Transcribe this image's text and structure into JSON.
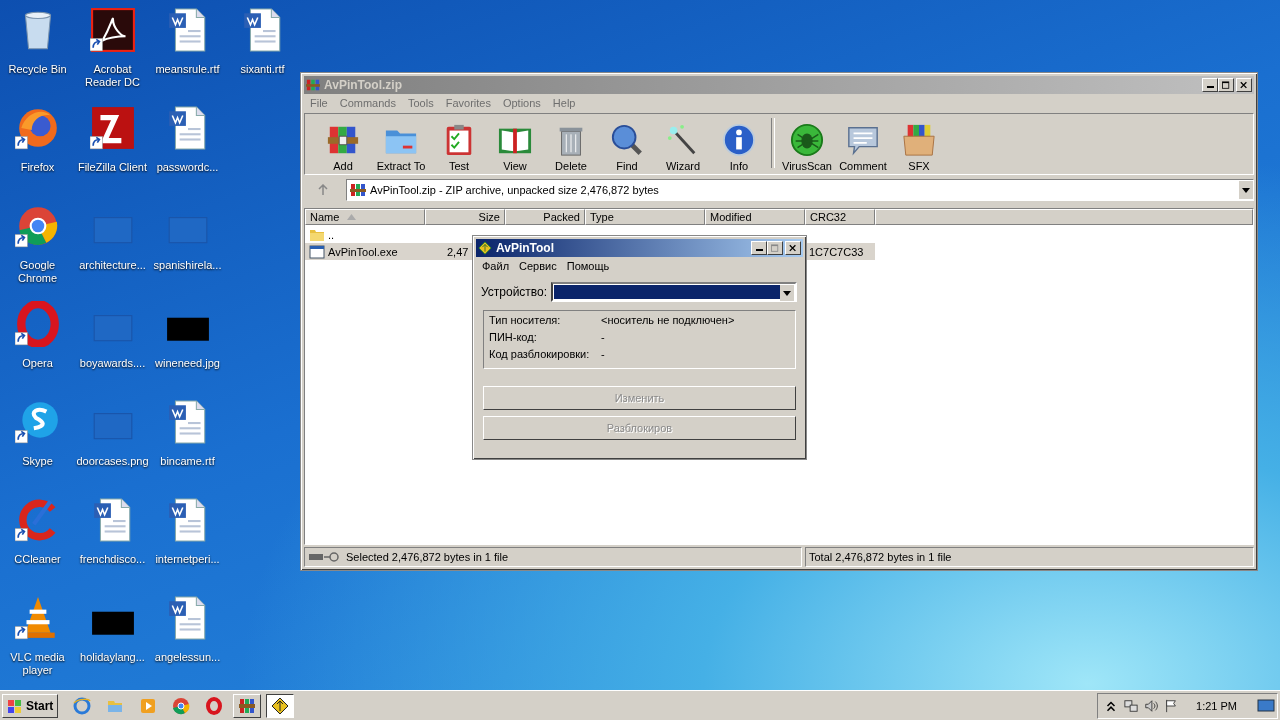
{
  "desktop": {
    "icons": [
      {
        "label": "Recycle Bin",
        "kind": "recycle",
        "shortcut": false
      },
      {
        "label": "Firefox",
        "kind": "firefox",
        "shortcut": true
      },
      {
        "label": "Google Chrome",
        "kind": "chrome",
        "shortcut": true
      },
      {
        "label": "Opera",
        "kind": "opera",
        "shortcut": true
      },
      {
        "label": "Skype",
        "kind": "skype",
        "shortcut": true
      },
      {
        "label": "CCleaner",
        "kind": "ccleaner",
        "shortcut": true
      },
      {
        "label": "VLC media player",
        "kind": "vlc",
        "shortcut": true
      },
      {
        "label": "Acrobat Reader DC",
        "kind": "acrobat",
        "shortcut": true
      },
      {
        "label": "FileZilla Client",
        "kind": "filezilla",
        "shortcut": true
      },
      {
        "label": "architecture...",
        "kind": "blank",
        "shortcut": false
      },
      {
        "label": "boyawards....",
        "kind": "blank",
        "shortcut": false
      },
      {
        "label": "doorcases.png",
        "kind": "blank",
        "shortcut": false
      },
      {
        "label": "frenchdisco...",
        "kind": "word",
        "shortcut": false
      },
      {
        "label": "holidaylang...",
        "kind": "black",
        "shortcut": false
      },
      {
        "label": "meansrule.rtf",
        "kind": "word",
        "shortcut": false
      },
      {
        "label": "passwordc...",
        "kind": "word",
        "shortcut": false
      },
      {
        "label": "spanishirela...",
        "kind": "blank",
        "shortcut": false
      },
      {
        "label": "wineneed.jpg",
        "kind": "black",
        "shortcut": false
      },
      {
        "label": "bincame.rtf",
        "kind": "word",
        "shortcut": false
      },
      {
        "label": "internetperi...",
        "kind": "word",
        "shortcut": false
      },
      {
        "label": "angelessun...",
        "kind": "word",
        "shortcut": false
      },
      {
        "label": "sixanti.rtf",
        "kind": "word",
        "shortcut": false
      }
    ]
  },
  "archive_window": {
    "title": "AvPinTool.zip",
    "active": false,
    "menu": [
      "File",
      "Commands",
      "Tools",
      "Favorites",
      "Options",
      "Help"
    ],
    "toolbar": [
      [
        {
          "label": "Add",
          "kind": "add"
        },
        {
          "label": "Extract To",
          "kind": "extract"
        },
        {
          "label": "Test",
          "kind": "test"
        },
        {
          "label": "View",
          "kind": "view"
        },
        {
          "label": "Delete",
          "kind": "delete"
        },
        {
          "label": "Find",
          "kind": "find"
        },
        {
          "label": "Wizard",
          "kind": "wizard"
        },
        {
          "label": "Info",
          "kind": "info"
        }
      ],
      [
        {
          "label": "VirusScan",
          "kind": "virusscan"
        },
        {
          "label": "Comment",
          "kind": "comment"
        },
        {
          "label": "SFX",
          "kind": "sfx"
        }
      ]
    ],
    "address": "AvPinTool.zip - ZIP archive, unpacked size 2,476,872 bytes",
    "columns": [
      {
        "label": "Name",
        "sorted": true
      },
      {
        "label": "Size",
        "sorted": false
      },
      {
        "label": "Packed",
        "sorted": false
      },
      {
        "label": "Type",
        "sorted": false
      },
      {
        "label": "Modified",
        "sorted": false
      },
      {
        "label": "CRC32",
        "sorted": false
      }
    ],
    "rows": [
      {
        "name": "..",
        "kind": "folder",
        "selected": false
      },
      {
        "name": "AvPinTool.exe",
        "kind": "exe",
        "size": "2,47",
        "crc32": "1C7C7C33",
        "selected": true
      }
    ],
    "status_bar": {
      "left": "Selected 2,476,872 bytes in 1 file",
      "right": "Total 2,476,872 bytes in 1 file"
    }
  },
  "dialog": {
    "title": "AvPinTool",
    "active": true,
    "menu": [
      "Файл",
      "Сервис",
      "Помощь"
    ],
    "device": {
      "label": "Устройство:",
      "focused": true
    },
    "info": [
      {
        "label": "Тип носителя:",
        "value": "<носитель не подключен>"
      },
      {
        "label": "ПИН-код:",
        "value": "-"
      },
      {
        "label": "Код разблокировки:",
        "value": "-"
      }
    ],
    "buttons": [
      {
        "label": "Изменить",
        "disabled": true
      },
      {
        "label": "Разблокиров",
        "disabled": true
      }
    ]
  },
  "taskbar": {
    "start": "Start",
    "items": [
      {
        "kind": "ie",
        "selected": false
      },
      {
        "kind": "explorer",
        "selected": false
      },
      {
        "kind": "media",
        "selected": false
      },
      {
        "kind": "chrome",
        "selected": false
      },
      {
        "kind": "opera",
        "selected": false
      },
      {
        "kind": "winrar",
        "selected": false
      },
      {
        "kind": "avpin",
        "selected": true
      }
    ],
    "time": "1:21 PM"
  }
}
